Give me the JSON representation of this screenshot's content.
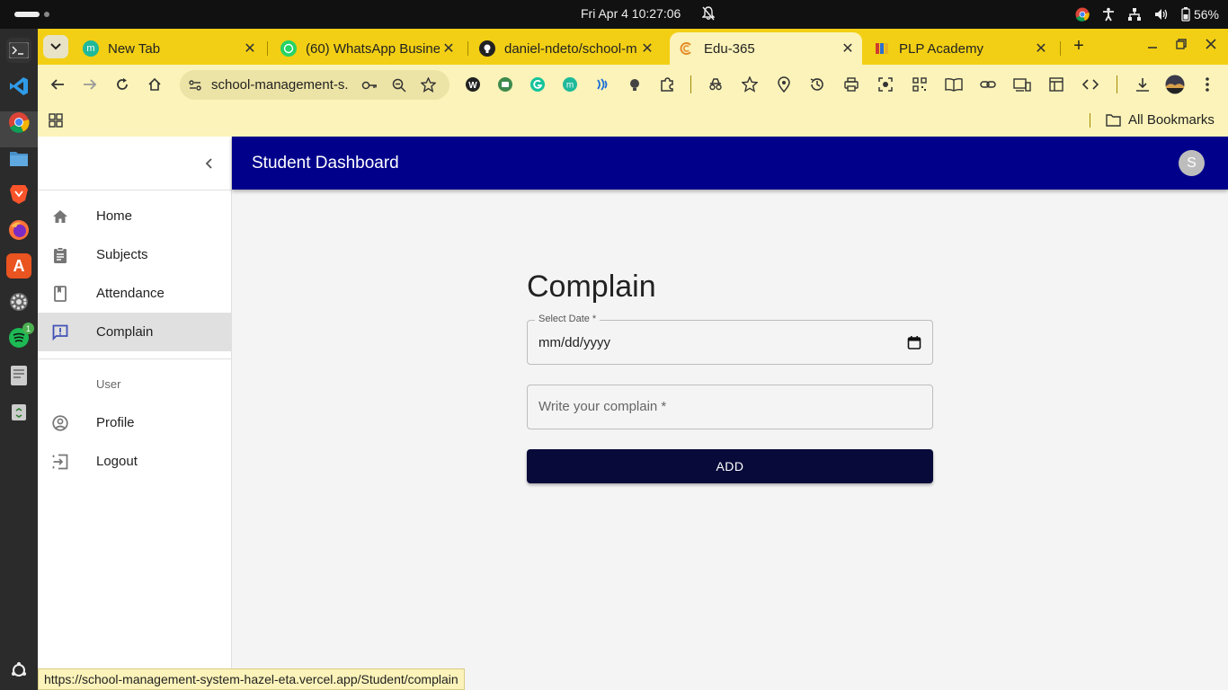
{
  "os": {
    "clock": "Fri Apr 4  10:27:06",
    "battery": "56%"
  },
  "browser": {
    "tabs": [
      {
        "label": "New Tab",
        "favicon": "m-icon"
      },
      {
        "label": "(60) WhatsApp Business",
        "favicon": "whatsapp-icon"
      },
      {
        "label": "daniel-ndeto/school-m",
        "favicon": "github-icon"
      },
      {
        "label": "Edu-365",
        "favicon": "edu-icon",
        "active": true
      },
      {
        "label": "PLP Academy",
        "favicon": "plp-icon"
      }
    ],
    "address": "school-management-s...",
    "bookmarks": {
      "all_label": "All Bookmarks"
    },
    "status_url": "https://school-management-system-hazel-eta.vercel.app/Student/complain"
  },
  "app": {
    "title": "Student Dashboard",
    "avatar_letter": "S",
    "accent_color": "#00008b",
    "sidebar": {
      "items": [
        {
          "label": "Home",
          "icon": "home-icon"
        },
        {
          "label": "Subjects",
          "icon": "assignment-icon"
        },
        {
          "label": "Attendance",
          "icon": "class-icon"
        },
        {
          "label": "Complain",
          "icon": "announcement-icon",
          "active": true
        }
      ],
      "section_label": "User",
      "user_items": [
        {
          "label": "Profile",
          "icon": "account-circle-icon"
        },
        {
          "label": "Logout",
          "icon": "exit-icon"
        }
      ]
    },
    "form": {
      "heading": "Complain",
      "date_label": "Select Date *",
      "date_value": "mm/dd/yyyy",
      "complain_placeholder": "Write your complain *",
      "submit_label": "ADD",
      "button_color": "#080a3a"
    }
  }
}
